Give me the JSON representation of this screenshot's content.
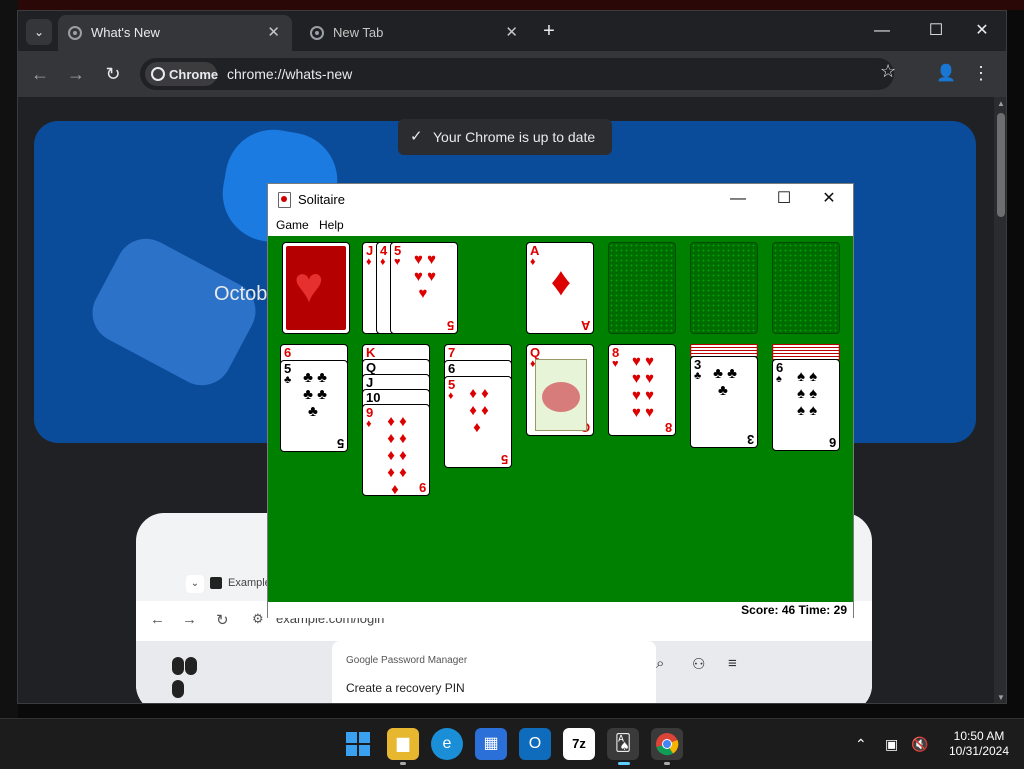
{
  "browser": {
    "tabs": [
      {
        "label": "What's New",
        "active": true
      },
      {
        "label": "New Tab",
        "active": false
      }
    ],
    "new_tab_glyph": "+",
    "site_chip": "Chrome",
    "url": "chrome://whats-new",
    "page": {
      "toast": "Your Chrome is up to date",
      "hero_text": "Octob",
      "preview": {
        "tab_label": "Example",
        "url": "example.com/login",
        "card_brand": "Google Password Manager",
        "card_heading": "Create a recovery PIN"
      }
    }
  },
  "solitaire": {
    "title": "Solitaire",
    "menu": [
      "Game",
      "Help"
    ],
    "status": "Score: 46 Time: 29",
    "stock_back": "red-heart",
    "waste": [
      {
        "rank": "J",
        "suit": "♦",
        "color": "red"
      },
      {
        "rank": "4",
        "suit": "♦",
        "color": "red"
      },
      {
        "rank": "5",
        "suit": "♥",
        "color": "red"
      }
    ],
    "foundations": [
      {
        "rank": "A",
        "suit": "♦",
        "color": "red"
      },
      null,
      null,
      null
    ],
    "tableau": [
      {
        "hidden": 0,
        "cards": [
          {
            "rank": "6",
            "suit": "♥",
            "color": "red"
          },
          {
            "rank": "5",
            "suit": "♣",
            "color": "blk"
          }
        ]
      },
      {
        "hidden": 0,
        "cards": [
          {
            "rank": "K",
            "suit": "♦",
            "color": "red"
          },
          {
            "rank": "Q",
            "suit": "♠",
            "color": "blk"
          },
          {
            "rank": "J",
            "suit": "♠",
            "color": "blk"
          },
          {
            "rank": "10",
            "suit": "♠",
            "color": "blk"
          },
          {
            "rank": "9",
            "suit": "♦",
            "color": "red"
          }
        ]
      },
      {
        "hidden": 0,
        "cards": [
          {
            "rank": "7",
            "suit": "♦",
            "color": "red"
          },
          {
            "rank": "6",
            "suit": "♠",
            "color": "blk"
          },
          {
            "rank": "5",
            "suit": "♦",
            "color": "red"
          }
        ]
      },
      {
        "hidden": 0,
        "cards": [
          {
            "rank": "Q",
            "suit": "♦",
            "color": "red"
          }
        ]
      },
      {
        "hidden": 0,
        "cards": [
          {
            "rank": "8",
            "suit": "♥",
            "color": "red"
          }
        ]
      },
      {
        "hidden": 4,
        "cards": [
          {
            "rank": "3",
            "suit": "♣",
            "color": "blk"
          }
        ]
      },
      {
        "hidden": 5,
        "cards": [
          {
            "rank": "6",
            "suit": "♠",
            "color": "blk"
          }
        ]
      }
    ]
  },
  "taskbar": {
    "apps": [
      "start-icon",
      "file-explorer-icon",
      "edge-icon",
      "store-icon",
      "outlook-icon",
      "7zip-icon",
      "solitaire-icon",
      "chrome-icon"
    ],
    "time": "10:50 AM",
    "date": "10/31/2024"
  },
  "colors": {
    "felt": "#008000",
    "chrome_bg": "#202124",
    "hero": "#0b4c9a",
    "taskbar": "#1c1c1c"
  }
}
